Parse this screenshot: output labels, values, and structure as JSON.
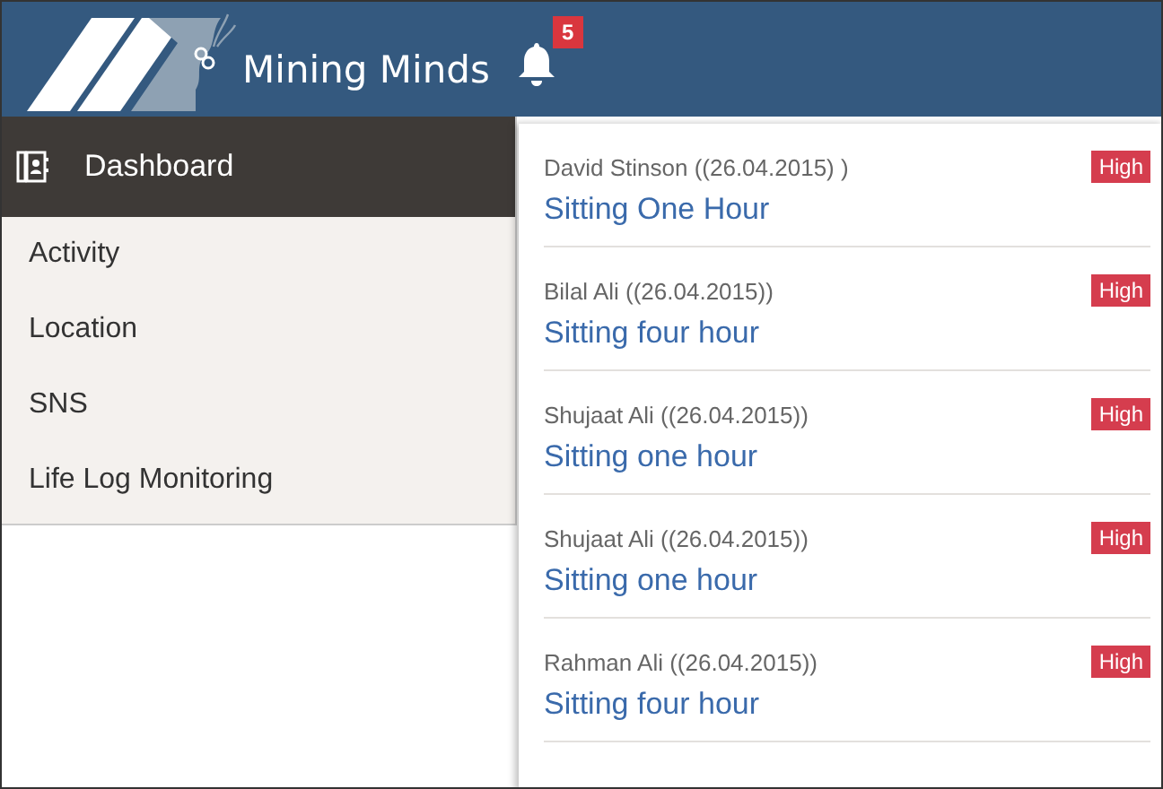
{
  "header": {
    "logo_text": "Mining Minds",
    "notification_count": "5"
  },
  "sidebar": {
    "items": [
      {
        "label": "Dashboard",
        "selected": true
      },
      {
        "label": "Activity",
        "selected": false
      },
      {
        "label": "Location",
        "selected": false
      },
      {
        "label": "SNS",
        "selected": false
      },
      {
        "label": "Life Log Monitoring",
        "selected": false
      }
    ]
  },
  "notifications": [
    {
      "sender": "David Stinson ((26.04.2015) )",
      "message": "Sitting One Hour",
      "priority": "High"
    },
    {
      "sender": "Bilal Ali ((26.04.2015))",
      "message": "Sitting four hour",
      "priority": "High"
    },
    {
      "sender": "Shujaat Ali ((26.04.2015))",
      "message": "Sitting one hour",
      "priority": "High"
    },
    {
      "sender": "Shujaat Ali ((26.04.2015))",
      "message": "Sitting one hour",
      "priority": "High"
    },
    {
      "sender": "Rahman Ali ((26.04.2015))",
      "message": "Sitting four hour",
      "priority": "High"
    }
  ]
}
